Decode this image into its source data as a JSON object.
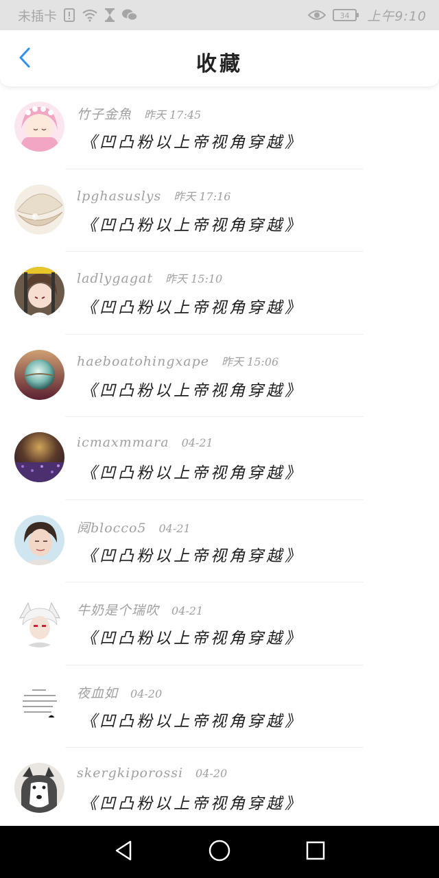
{
  "status_bar": {
    "carrier": "未插卡",
    "battery": "34",
    "time": "上午9:10",
    "icons": [
      "sim-alert-icon",
      "wifi-icon",
      "hourglass-icon",
      "wechat-icon",
      "eye-icon",
      "battery-icon"
    ]
  },
  "header": {
    "title": "收藏",
    "back_icon": "chevron-left-icon"
  },
  "colors": {
    "accent": "#2f8ff0",
    "status_bar_bg": "#e3e3e3",
    "nav_bar_bg": "#000000",
    "meta_text": "#a0a0a0"
  },
  "favorites": [
    {
      "user": "竹子金魚",
      "time": "昨天 17:45",
      "content": "《凹凸粉以上帝视角穿越》",
      "avatar": "pink-anime-girl-avatar"
    },
    {
      "user": "lpghasuslys",
      "time": "昨天 17:16",
      "content": "《凹凸粉以上帝视角穿越》",
      "avatar": "pearl-shell-avatar"
    },
    {
      "user": "ladlygagat",
      "time": "昨天 15:10",
      "content": "《凹凸粉以上帝视角穿越》",
      "avatar": "anime-boy-avatar"
    },
    {
      "user": "haeboatohingxape",
      "time": "昨天 15:06",
      "content": "《凹凸粉以上帝视角穿越》",
      "avatar": "crystal-ball-avatar"
    },
    {
      "user": "icmaxmmara",
      "time": "04-21",
      "content": "《凹凸粉以上帝视角穿越》",
      "avatar": "purple-field-avatar"
    },
    {
      "user": "阋blocco5",
      "time": "04-21",
      "content": "《凹凸粉以上帝视角穿越》",
      "avatar": "portrait-avatar"
    },
    {
      "user": "牛奶是个瑞吹",
      "time": "04-21",
      "content": "《凹凸粉以上帝视角穿越》",
      "avatar": "white-hair-character-avatar"
    },
    {
      "user": "夜血如",
      "time": "04-20",
      "content": "《凹凸粉以上帝视角穿越》",
      "avatar": "handwritten-note-avatar"
    },
    {
      "user": "skergkiporossi",
      "time": "04-20",
      "content": "《凹凸粉以上帝视角穿越》",
      "avatar": "husky-dog-avatar"
    }
  ],
  "nav_bar": {
    "buttons": [
      "back-triangle-icon",
      "home-circle-icon",
      "recents-square-icon"
    ]
  }
}
